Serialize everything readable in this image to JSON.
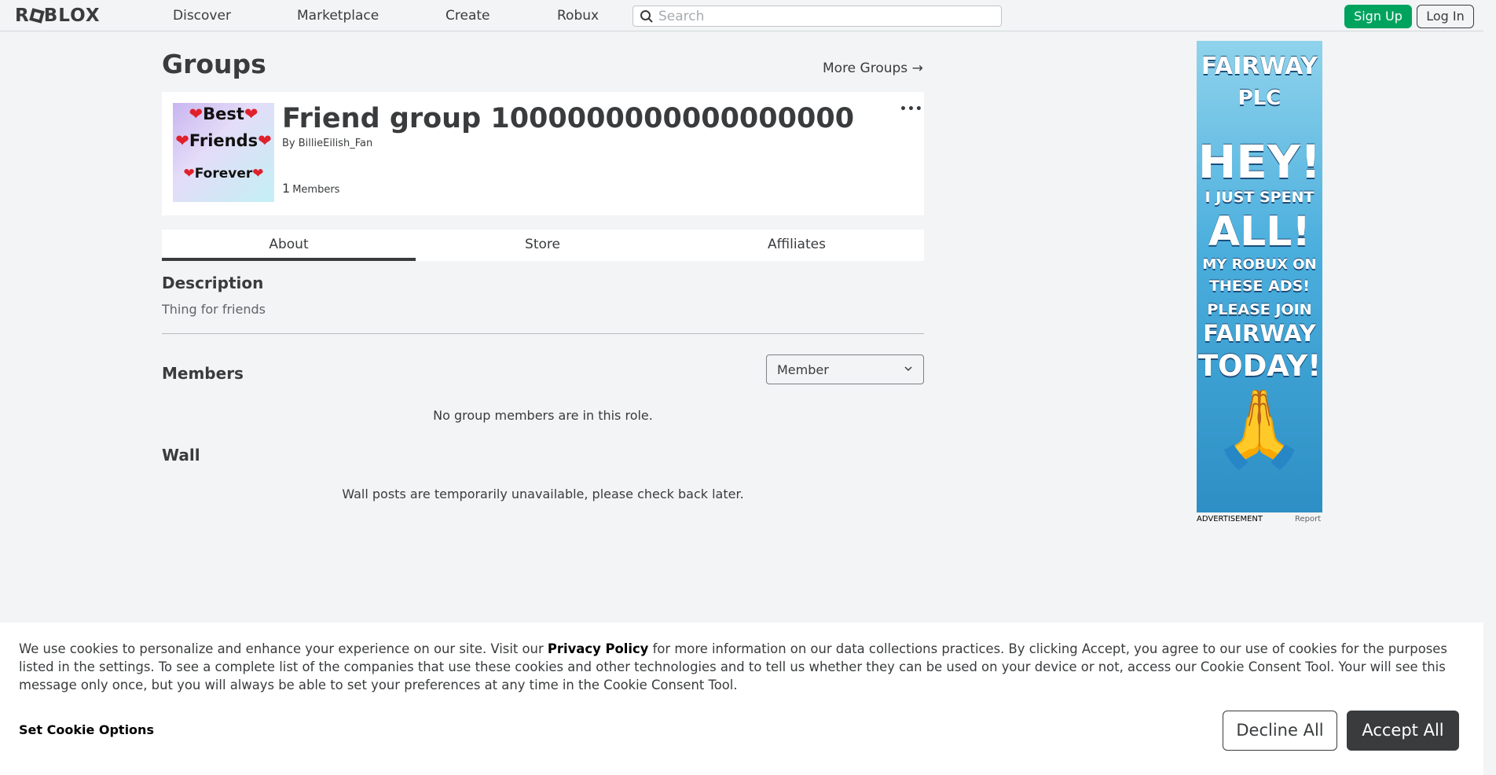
{
  "header": {
    "logo": "ROBLOX",
    "nav": [
      "Discover",
      "Marketplace",
      "Create",
      "Robux"
    ],
    "search_placeholder": "Search",
    "signup_label": "Sign Up",
    "login_label": "Log In"
  },
  "page": {
    "title": "Groups",
    "more_groups": "More Groups",
    "more_groups_arrow": "→"
  },
  "group": {
    "name": "Friend group 1000000000000000000",
    "by_prefix": "By",
    "owner": "BillieEilish_Fan",
    "member_count": "1",
    "members_label": "Members",
    "menu_dots": "•••",
    "thumbnail_lines": [
      "Best",
      "Friends",
      "Forever"
    ]
  },
  "tabs": [
    "About",
    "Store",
    "Affiliates"
  ],
  "about": {
    "description_heading": "Description",
    "description": "Thing for friends",
    "members_heading": "Members",
    "role_selected": "Member",
    "no_members": "No group members are in this role.",
    "wall_heading": "Wall",
    "wall_message": "Wall posts are temporarily unavailable, please check back later."
  },
  "ad": {
    "lines": [
      "FAIRWAY",
      "PLC",
      "HEY!",
      "I JUST SPENT",
      "ALL!",
      "MY ROBUX ON",
      "THESE ADS!",
      "PLEASE JOIN",
      "FAIRWAY",
      "TODAY!"
    ],
    "emoji": "🙏",
    "label": "ADVERTISEMENT",
    "report": "Report"
  },
  "cookie": {
    "text_before": "We use cookies to personalize and enhance your experience on our site. Visit our ",
    "privacy_link": "Privacy Policy",
    "text_after": " for more information on our data collections practices. By clicking Accept, you agree to our use of cookies for the purposes listed in the settings. To see a complete list of the companies that use these cookies and other technologies and to tell us whether they can be used on your device or not, access our Cookie Consent Tool. Your will see this message only once, but you will always be able to set your preferences at any time in the Cookie Consent Tool.",
    "set_options": "Set Cookie Options",
    "decline": "Decline All",
    "accept": "Accept All"
  },
  "colors": {
    "signup_green": "#00a35e",
    "text_dark": "#393b3d",
    "page_bg": "#f2f4f5"
  }
}
